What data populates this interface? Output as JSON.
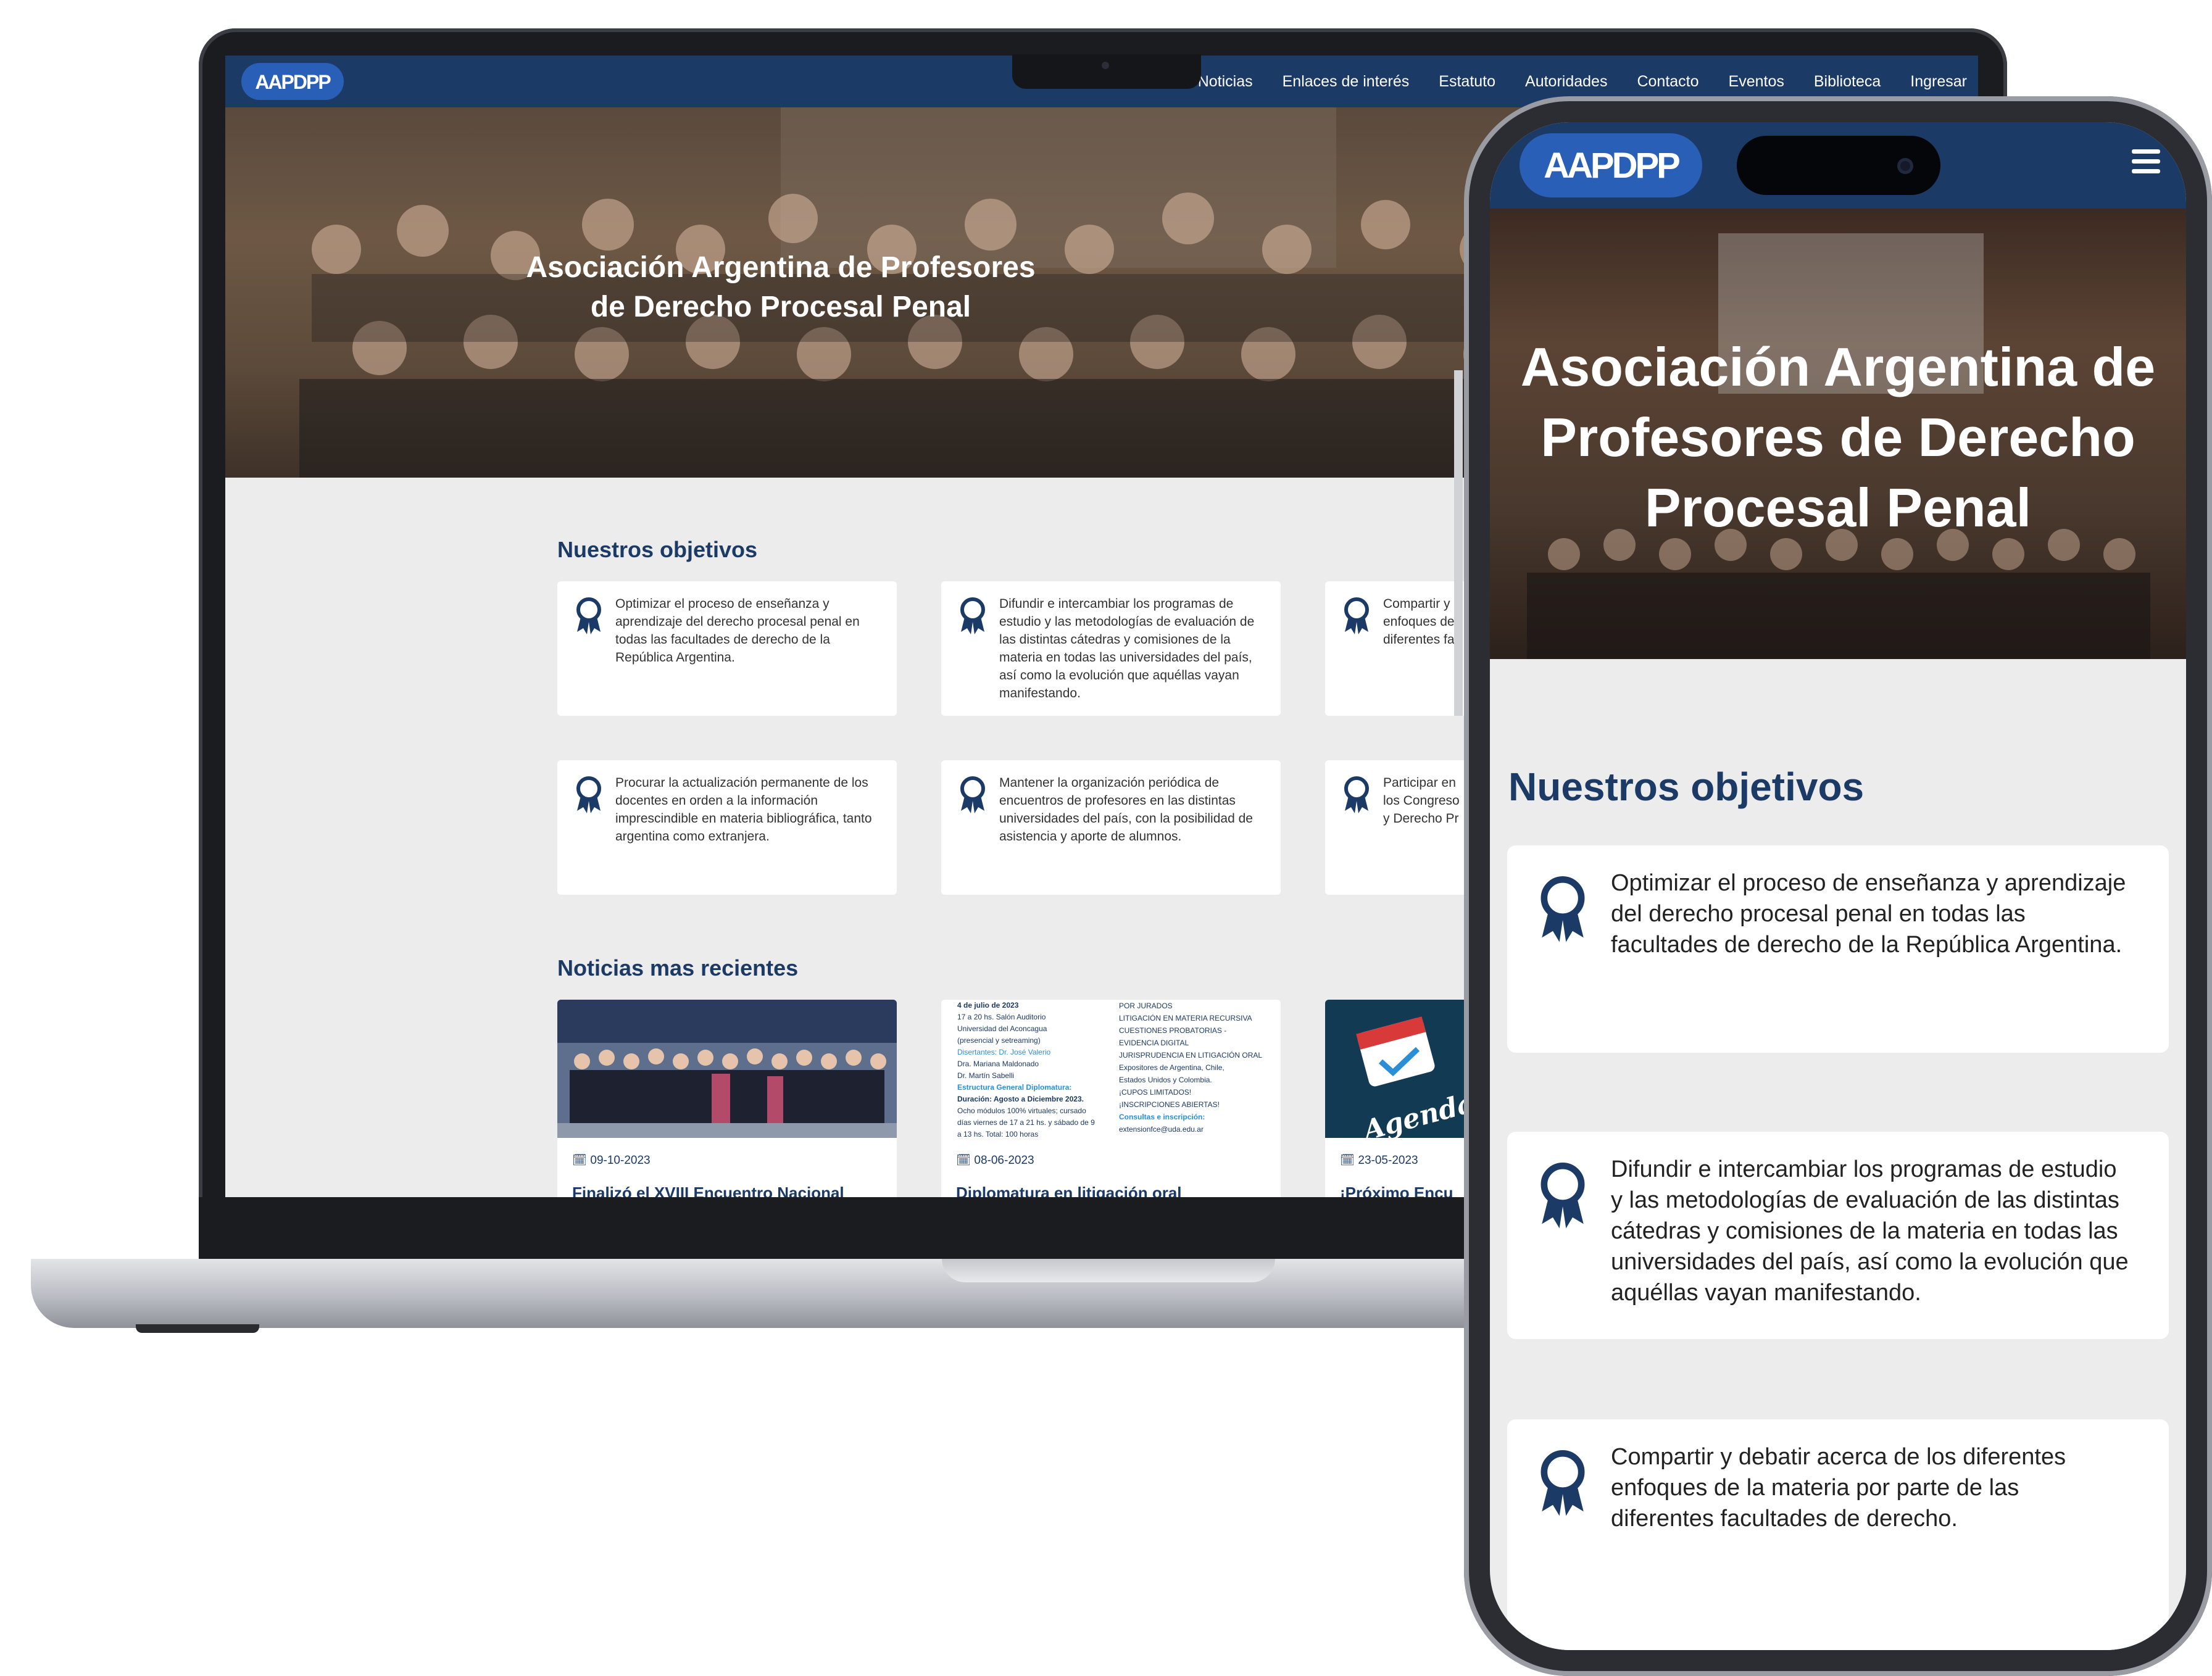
{
  "site": {
    "logo_text": "AAPDPP",
    "nav_items": [
      "Noticias",
      "Enlaces de interés",
      "Estatuto",
      "Autoridades",
      "Contacto",
      "Eventos",
      "Biblioteca",
      "Ingresar"
    ],
    "hero_title": "Asociación Argentina de Profesores de Derecho Procesal Penal",
    "hero_title_line1": "Asociación Argentina de Profesores",
    "hero_title_line2": "de Derecho Procesal Penal",
    "objectives_heading": "Nuestros objetivos",
    "objectives": [
      "Optimizar el proceso de enseñanza y aprendizaje del derecho procesal penal en todas las facultades de derecho de la República Argentina.",
      "Difundir e intercambiar los programas de estudio y las metodologías de evaluación de las distintas cátedras y comisiones de la materia en todas las universidades del país, así como la evolución que aquéllas vayan manifestando.",
      "Compartir y debatir acerca de los diferentes enfoques de la materia por parte de las diferentes facultades de derecho.",
      "Procurar la actualización permanente de los docentes en orden a la información imprescindible en materia bibliográfica, tanto argentina como extranjera.",
      "Mantener la organización periódica de encuentros de profesores en las distintas universidades del país, con la posibilidad de asistencia y aporte de alumnos.",
      "Participar en los Congresos y Derecho Pr"
    ],
    "objectives_clipped": {
      "c3": [
        "Compartir y d",
        "enfoques de",
        "diferentes fa"
      ],
      "c6": [
        "Participar en",
        "los Congreso",
        "y Derecho Pr"
      ]
    },
    "news_heading": "Noticias mas recientes",
    "news": [
      {
        "date": "09-10-2023",
        "title": "Finalizó el XVIII Encuentro Nacional"
      },
      {
        "date": "08-06-2023",
        "title": "Diplomatura en litigación oral"
      },
      {
        "date": "23-05-2023",
        "title": "¡Próximo Encu"
      }
    ],
    "flyer": {
      "left": [
        "4 de julio de 2023",
        "17 a 20 hs. Salón Auditorio",
        "Universidad del Aconcagua",
        "(presencial y setreaming)",
        "Disertantes: Dr. José Valerio",
        "Dra. Mariana Maldonado",
        "Dr. Martín Sabelli",
        "Estructura General Diplomatura:",
        "Duración: Agosto a Diciembre 2023.",
        "Ocho módulos 100% virtuales; cursado",
        "días viernes de 17 a 21 hs. y sábado de 9",
        "a 13 hs. Total: 100 horas"
      ],
      "right": [
        "POR JURADOS",
        "LITIGACIÓN EN MATERIA RECURSIVA",
        "CUESTIONES PROBATORIAS -",
        "EVIDENCIA DIGITAL",
        "JURISPRUDENCIA EN LITIGACIÓN ORAL",
        "Expositores de Argentina, Chile,",
        "Estados Unidos y Colombia.",
        "¡CUPOS LIMITADOS!",
        "¡INSCRIPCIONES ABIERTAS!",
        "Consultas e inscripción:",
        "extensionfce@uda.edu.ar"
      ],
      "agenda": "Agendalo!"
    }
  },
  "phone": {
    "hero_lines": [
      "Asociación Argentina de",
      "Profesores de Derecho",
      "Procesal Penal"
    ],
    "objectives_heading": "Nuestros objetivos",
    "cards": [
      [
        "Optimizar el proceso de enseñanza y aprendizaje",
        "del derecho procesal penal en todas las",
        "facultades de derecho de la República Argentina."
      ],
      [
        "Difundir e intercambiar los programas de estudio",
        "y las metodologías de evaluación de las distintas",
        "cátedras y comisiones de la materia en todas las",
        "universidades del país, así como la evolución que",
        "aquéllas vayan manifestando."
      ],
      [
        "Compartir y debatir acerca de los diferentes",
        "enfoques de la materia por parte de las",
        "diferentes facultades de derecho."
      ]
    ]
  },
  "colors": {
    "brand_navy": "#1c3a66",
    "page_bg": "#ececec",
    "card_bg": "#ffffff",
    "logo_blue": "#2a5fb8"
  },
  "icons": [
    "award-ribbon-icon",
    "calendar-icon",
    "hamburger-menu-icon"
  ]
}
